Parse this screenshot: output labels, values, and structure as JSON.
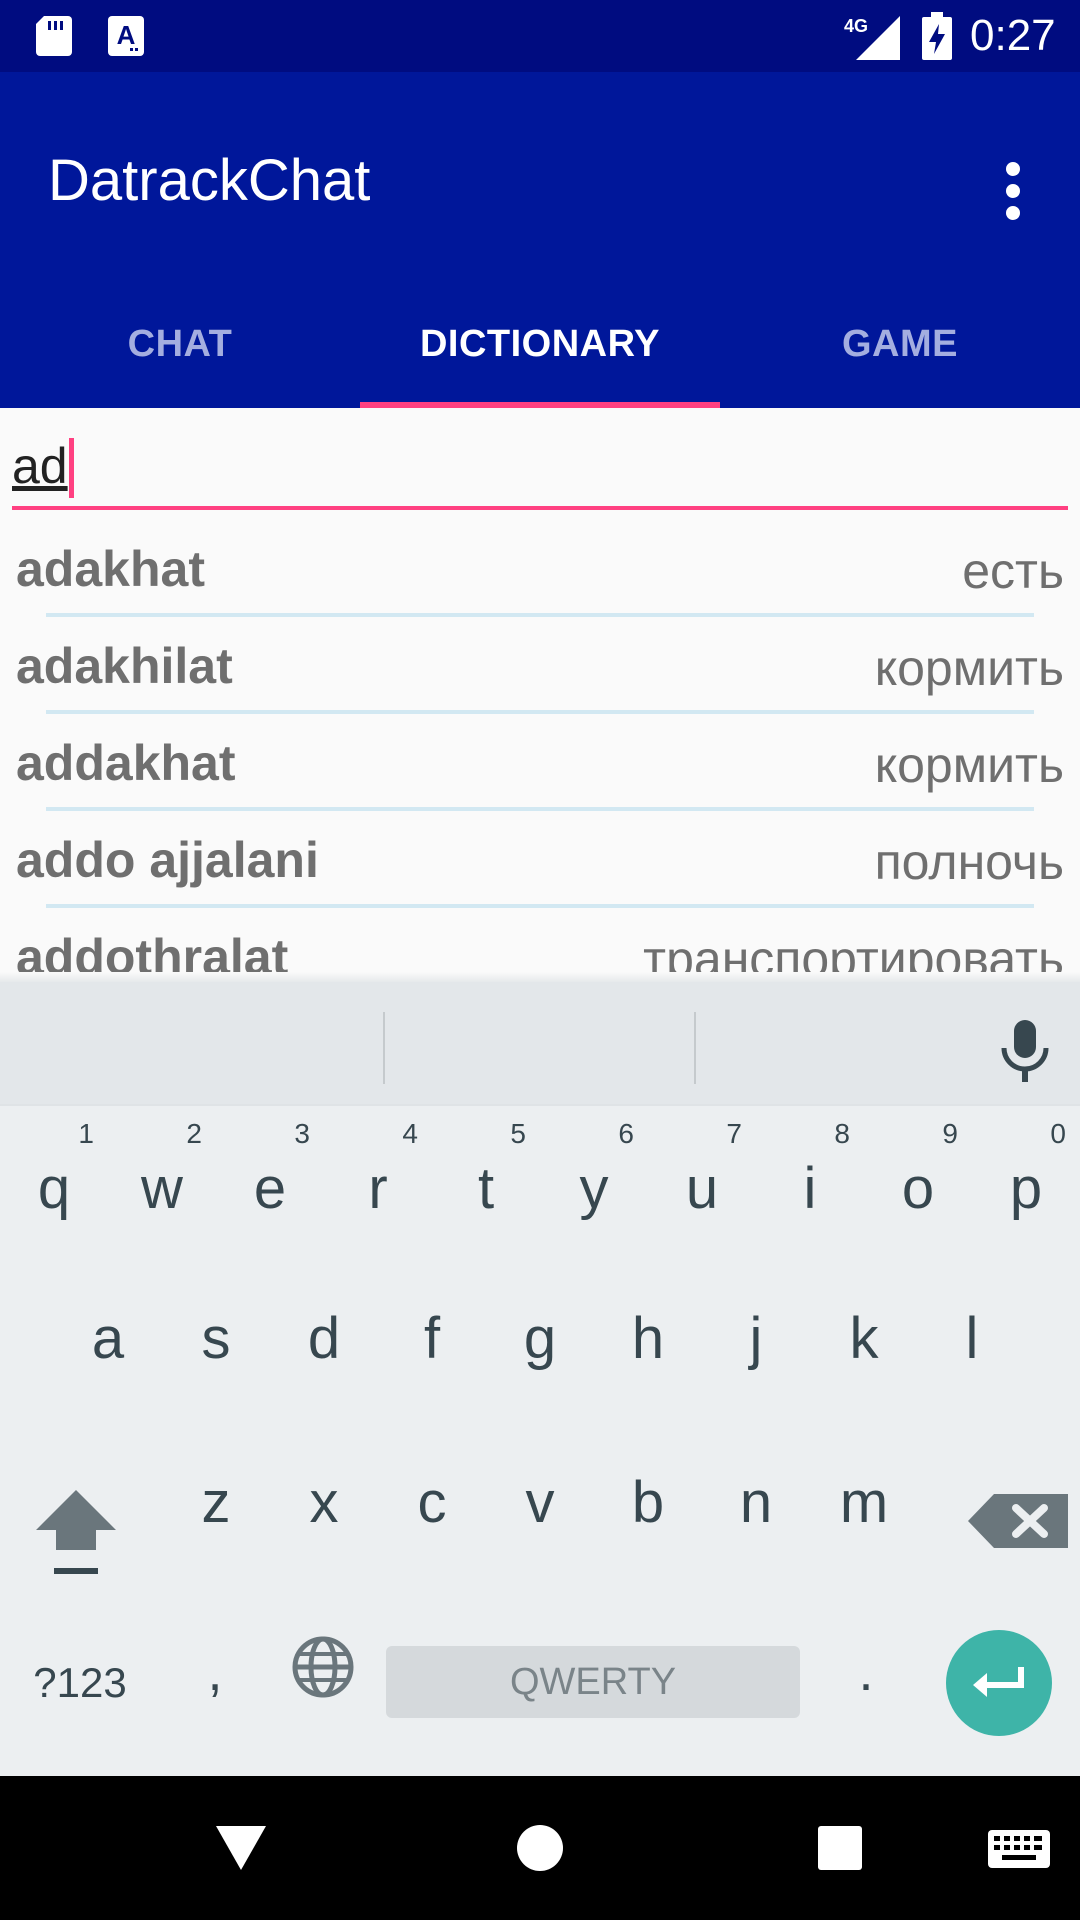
{
  "status_bar": {
    "time": "0:27",
    "network": "4G",
    "icons": [
      "sd-card-icon",
      "a-notification-icon",
      "signal-icon",
      "battery-charging-icon"
    ]
  },
  "app_bar": {
    "title": "DatrackChat",
    "overflow_icon": "more-vert-icon",
    "tabs": [
      {
        "label": "CHAT",
        "active": false
      },
      {
        "label": "DICTIONARY",
        "active": true
      },
      {
        "label": "GAME",
        "active": false
      }
    ],
    "accent_color": "#ff4081",
    "primary_color": "#00179a"
  },
  "search": {
    "value": "ad",
    "placeholder": ""
  },
  "results": [
    {
      "word": "adakhat",
      "translation": "есть"
    },
    {
      "word": "adakhilat",
      "translation": "кормить"
    },
    {
      "word": "addakhat",
      "translation": "кормить"
    },
    {
      "word": "addo ajjalani",
      "translation": "полночь"
    },
    {
      "word": "addothralat",
      "translation": "транспортировать"
    }
  ],
  "keyboard": {
    "row1": [
      {
        "ch": "q",
        "hint": "1"
      },
      {
        "ch": "w",
        "hint": "2"
      },
      {
        "ch": "e",
        "hint": "3"
      },
      {
        "ch": "r",
        "hint": "4"
      },
      {
        "ch": "t",
        "hint": "5"
      },
      {
        "ch": "y",
        "hint": "6"
      },
      {
        "ch": "u",
        "hint": "7"
      },
      {
        "ch": "i",
        "hint": "8"
      },
      {
        "ch": "o",
        "hint": "9"
      },
      {
        "ch": "p",
        "hint": "0"
      }
    ],
    "row2": [
      "a",
      "s",
      "d",
      "f",
      "g",
      "h",
      "j",
      "k",
      "l"
    ],
    "row3": [
      "z",
      "x",
      "c",
      "v",
      "b",
      "n",
      "m"
    ],
    "symbols_label": "?123",
    "comma": ",",
    "period": ".",
    "space_label": "QWERTY",
    "enter_color": "#3eb4a8"
  }
}
